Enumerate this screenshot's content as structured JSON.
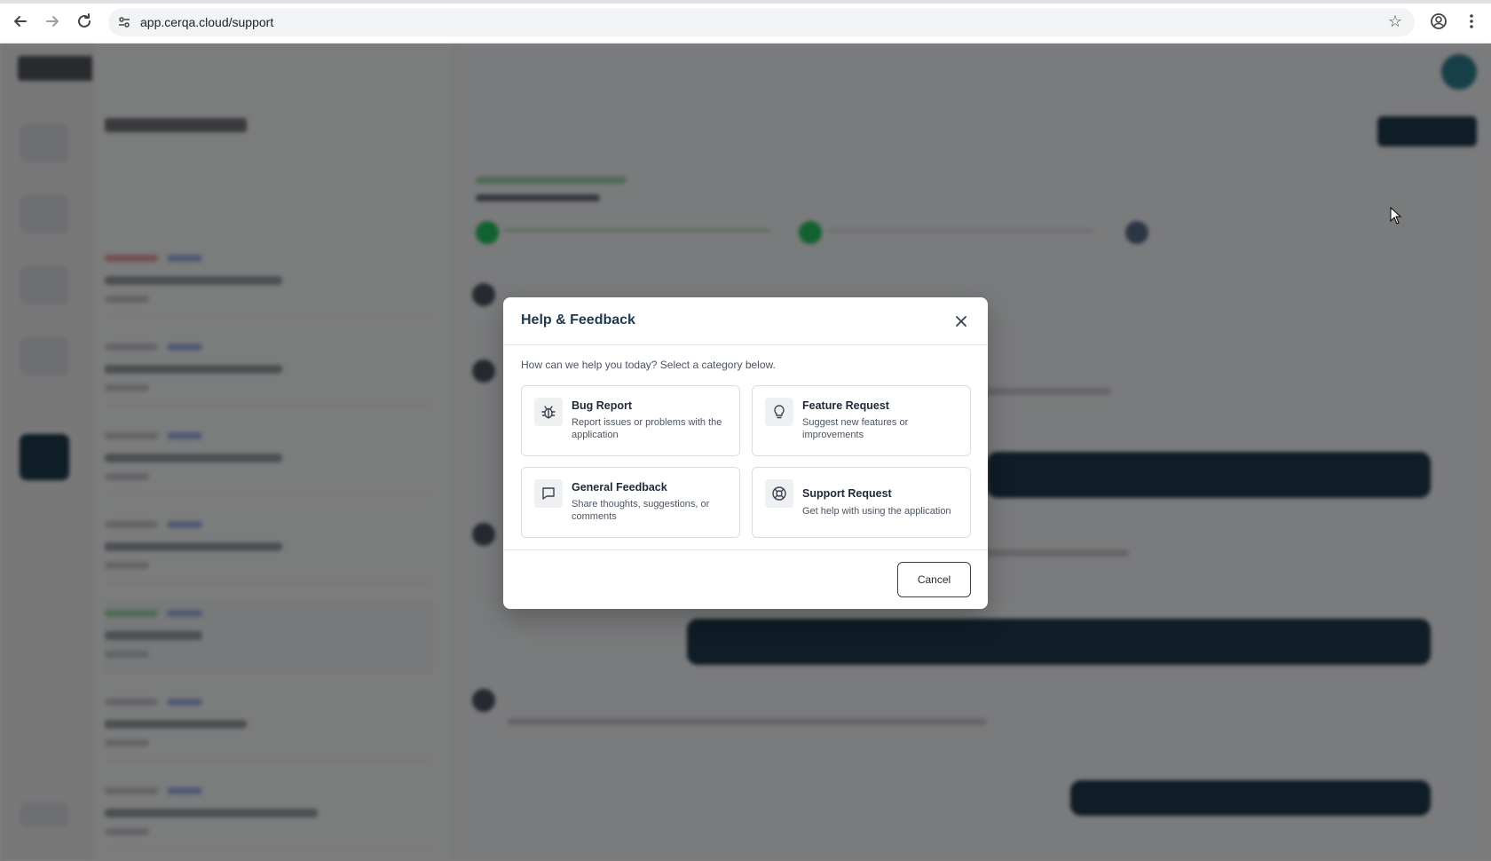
{
  "browser": {
    "url": "app.cerqa.cloud/support"
  },
  "dialog": {
    "title": "Help & Feedback",
    "intro": "How can we help you today? Select a category below.",
    "options": [
      {
        "title": "Bug Report",
        "description": "Report issues or problems with the application",
        "icon": "bug-icon"
      },
      {
        "title": "Feature Request",
        "description": "Suggest new features or improvements",
        "icon": "lightbulb-icon"
      },
      {
        "title": "General Feedback",
        "description": "Share thoughts, suggestions, or comments",
        "icon": "chat-bubble-icon"
      },
      {
        "title": "Support Request",
        "description": "Get help with using the application",
        "icon": "lifebuoy-icon"
      }
    ],
    "cancel_label": "Cancel"
  },
  "colors": {
    "accent": "#1e3a4c",
    "overlay": "rgba(0,0,0,0.5)",
    "success": "#22c55e"
  }
}
